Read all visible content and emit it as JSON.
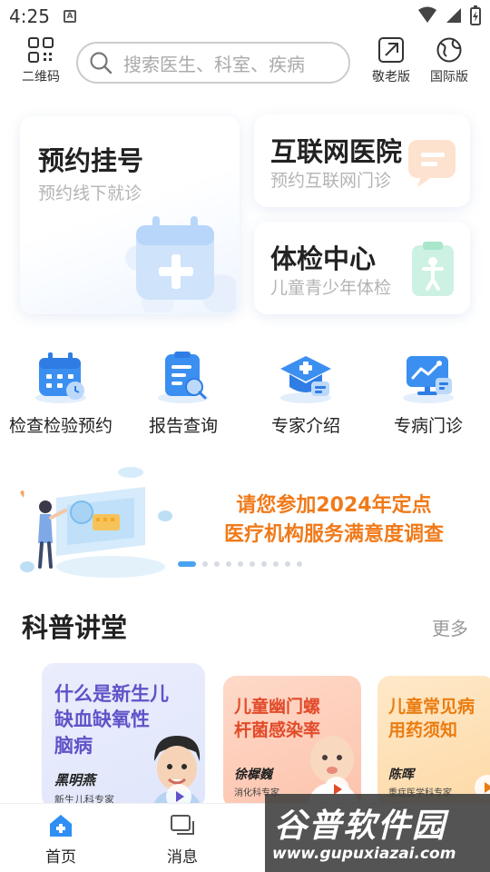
{
  "status_bar": {
    "time": "4:25",
    "notification_letter": "A"
  },
  "top_bar": {
    "qr_label": "二维码",
    "search_placeholder": "搜索医生、科室、疾病",
    "elder_label": "敬老版",
    "intl_label": "国际版"
  },
  "cards": {
    "appointment": {
      "title": "预约挂号",
      "subtitle": "预约线下就诊"
    },
    "internet_hospital": {
      "title": "互联网医院",
      "subtitle": "预约互联网门诊"
    },
    "checkup": {
      "title": "体检中心",
      "subtitle": "儿童青少年体检"
    }
  },
  "quick_entries": [
    {
      "label": "检查检验预约",
      "icon": "calendar-icon"
    },
    {
      "label": "报告查询",
      "icon": "report-search-icon"
    },
    {
      "label": "专家介绍",
      "icon": "expert-cap-icon"
    },
    {
      "label": "专病门诊",
      "icon": "monitor-chart-icon"
    }
  ],
  "banner": {
    "line1": "请您参加2024年定点",
    "line2": "医疗机构服务满意度调查",
    "page_count": 10,
    "active_page": 1
  },
  "science_section": {
    "title": "科普讲堂",
    "more_label": "更多"
  },
  "lectures": [
    {
      "title_line1": "什么是新生儿",
      "title_line2": "缺血缺氧性",
      "title_line3": "脑病",
      "doctor": "黑明燕",
      "specialty": "新生儿科专家"
    },
    {
      "title_line1": "儿童幽门螺",
      "title_line2": "杆菌感染率",
      "doctor": "徐樨巍",
      "specialty": "消化科专家"
    },
    {
      "title_line1": "儿童常见病",
      "title_line2": "用药须知",
      "doctor": "陈晖",
      "specialty": "重症医学科专家"
    }
  ],
  "bottom_nav": [
    {
      "label": "首页",
      "active": true
    },
    {
      "label": "消息",
      "active": false
    }
  ],
  "watermark": {
    "title": "谷普软件园",
    "url": "www.gupuxiazai.com"
  },
  "colors": {
    "accent_blue": "#2f8ef3",
    "banner_orange": "#f07a1a",
    "nav_active": "#2f8ef3"
  }
}
